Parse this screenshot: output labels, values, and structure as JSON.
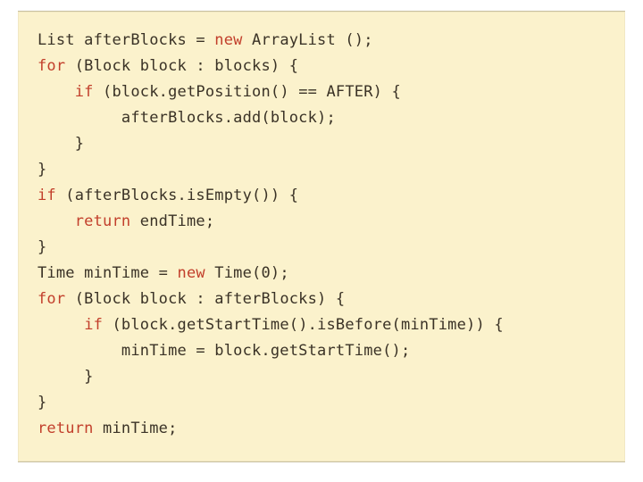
{
  "code": {
    "tokens": [
      [
        {
          "t": "List afterBlocks = "
        },
        {
          "t": "new",
          "c": "kw"
        },
        {
          "t": " ArrayList ();"
        }
      ],
      [
        {
          "t": "for",
          "c": "kw"
        },
        {
          "t": " (Block block : blocks) {"
        }
      ],
      [
        {
          "t": "    "
        },
        {
          "t": "if",
          "c": "kw"
        },
        {
          "t": " (block.getPosition() == AFTER) {"
        }
      ],
      [
        {
          "t": "         afterBlocks.add(block);"
        }
      ],
      [
        {
          "t": "    }"
        }
      ],
      [
        {
          "t": "}"
        }
      ],
      [
        {
          "t": "if",
          "c": "kw"
        },
        {
          "t": " (afterBlocks.isEmpty()) {"
        }
      ],
      [
        {
          "t": "    "
        },
        {
          "t": "return",
          "c": "kw"
        },
        {
          "t": " endTime;"
        }
      ],
      [
        {
          "t": "}"
        }
      ],
      [
        {
          "t": "Time minTime = "
        },
        {
          "t": "new",
          "c": "kw"
        },
        {
          "t": " Time(0);"
        }
      ],
      [
        {
          "t": "for",
          "c": "kw"
        },
        {
          "t": " (Block block : afterBlocks) {"
        }
      ],
      [
        {
          "t": "     "
        },
        {
          "t": "if",
          "c": "kw"
        },
        {
          "t": " (block.getStartTime().isBefore(minTime)) {"
        }
      ],
      [
        {
          "t": "         minTime = block.getStartTime();"
        }
      ],
      [
        {
          "t": "     }"
        }
      ],
      [
        {
          "t": "}"
        }
      ],
      [
        {
          "t": "return",
          "c": "kw"
        },
        {
          "t": " minTime;"
        }
      ]
    ]
  }
}
